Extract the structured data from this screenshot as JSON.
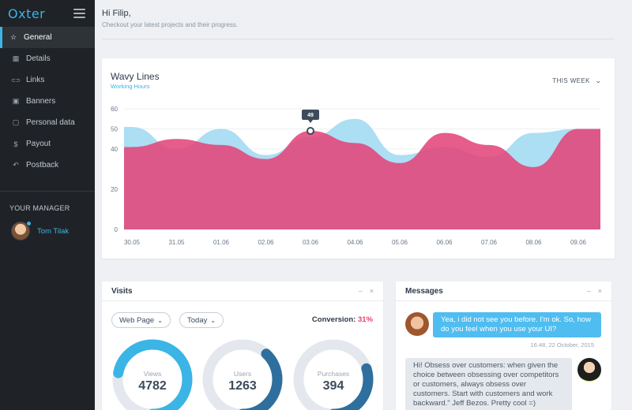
{
  "app": {
    "logo": "Oxter"
  },
  "sidebar": {
    "items": [
      {
        "label": "General",
        "icon": "star-icon",
        "glyph": "☆",
        "active": true
      },
      {
        "label": "Details",
        "icon": "grid-icon",
        "glyph": "▦"
      },
      {
        "label": "Links",
        "icon": "link-icon",
        "glyph": "⊂⊃"
      },
      {
        "label": "Banners",
        "icon": "banner-icon",
        "glyph": "▣"
      },
      {
        "label": "Personal data",
        "icon": "lock-icon",
        "glyph": "▢"
      },
      {
        "label": "Payout",
        "icon": "dollar-icon",
        "glyph": "$"
      },
      {
        "label": "Postback",
        "icon": "back-icon",
        "glyph": "↶"
      }
    ],
    "manager_title": "YOUR MANAGER",
    "manager_name": "Tom Tilak"
  },
  "header": {
    "greeting": "Hi Filip,",
    "subtitle": "Checkout your latest projects and their progress."
  },
  "chart_panel": {
    "title": "Wavy Lines",
    "subtitle": "Working Hours",
    "period": "THIS WEEK"
  },
  "chart_data": {
    "type": "area",
    "title": "Wavy Lines",
    "subtitle": "Working Hours",
    "x": [
      "30.05",
      "31.05",
      "01.06",
      "02.06",
      "03.06",
      "04.06",
      "05.06",
      "06.06",
      "07.06",
      "08.06",
      "09.06"
    ],
    "ylim": [
      0,
      60
    ],
    "yticks": [
      0,
      20,
      40,
      50,
      60
    ],
    "grid": true,
    "colors": {
      "blue": "#a8dcf3",
      "pink": "#e3457a"
    },
    "series": [
      {
        "values": [
          51,
          40,
          50,
          37,
          46,
          55,
          37,
          41,
          36,
          48,
          50
        ],
        "color": "#a8dcf3"
      },
      {
        "values": [
          41,
          45,
          42,
          35,
          49,
          43,
          33,
          48,
          42,
          31,
          50
        ],
        "color": "#e3457a"
      }
    ],
    "tooltip": {
      "x": "03.06",
      "value": 49,
      "label": "49"
    }
  },
  "visits": {
    "title": "Visits",
    "dropdown1": "Web Page",
    "dropdown2": "Today",
    "conversion_label": "Conversion:",
    "conversion_value": "31%",
    "donuts": [
      {
        "label": "Views",
        "value": "4782",
        "fraction": 0.72,
        "color": "#3bb4e6"
      },
      {
        "label": "Users",
        "value": "1263",
        "fraction": 0.38,
        "color": "#2e6f9e"
      },
      {
        "label": "Purchases",
        "value": "394",
        "fraction": 0.3,
        "color": "#2e6f9e"
      }
    ]
  },
  "messages": {
    "title": "Messages",
    "incoming": "Yea, i did not see you before. I'm ok. So, how do you feel when you use your UI?",
    "time": "16:48, 22 October, 2015",
    "outgoing": "Hi! Obsess over customers: when given the choice between obsessing over competitors or customers, always obsess over customers. Start with customers and work backward.\" Jeff Bezos. Pretty cool =)"
  },
  "controls": {
    "minimize": "–",
    "close": "×",
    "chevron": "⌄"
  }
}
